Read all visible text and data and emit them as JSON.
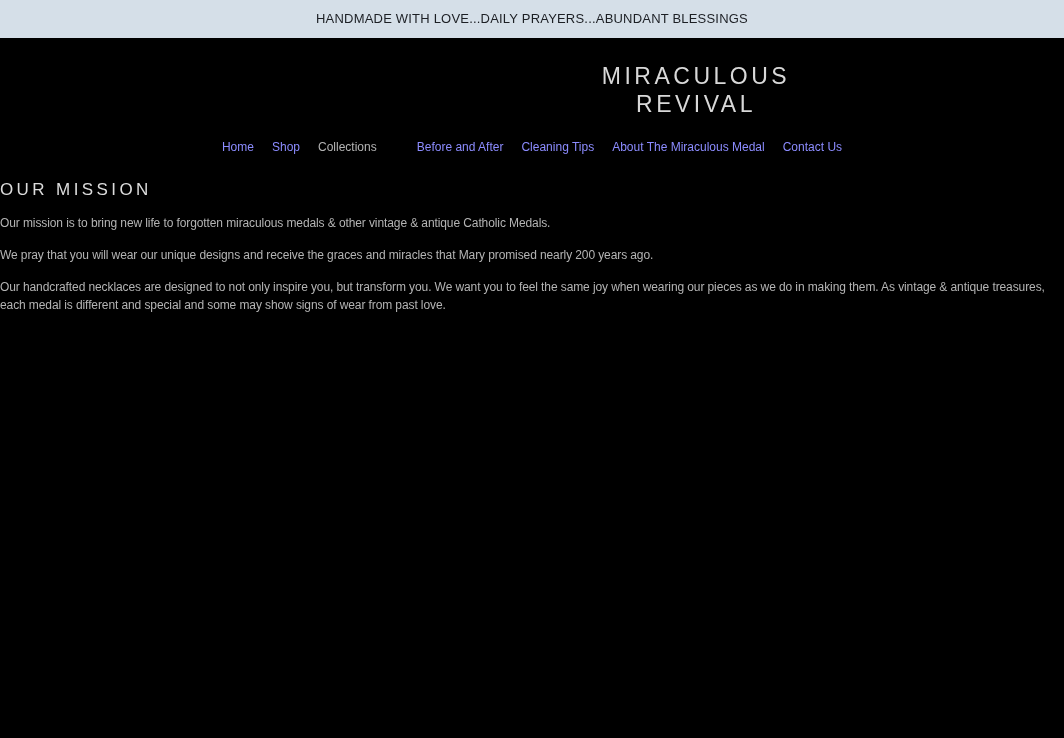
{
  "announcement_bar": {
    "text": "HANDMADE WITH LOVE...DAILY PRAYERS...ABUNDANT BLESSINGS"
  },
  "logo": {
    "lines": [
      "MIRACULOUS",
      "REVIVAL"
    ]
  },
  "nav": {
    "items": [
      {
        "label": "Home",
        "kind": "link"
      },
      {
        "label": "Shop",
        "kind": "link"
      },
      {
        "label": "Collections",
        "kind": "dropdown"
      },
      {
        "label": "Before and After",
        "kind": "link"
      },
      {
        "label": "Cleaning Tips",
        "kind": "link"
      },
      {
        "label": "About The Miraculous Medal",
        "kind": "link"
      },
      {
        "label": "Contact Us",
        "kind": "link"
      }
    ]
  },
  "mission": {
    "heading": "OUR MISSION",
    "paragraphs": [
      "Our mission is to bring new life to forgotten miraculous medals & other vintage & antique Catholic Medals.",
      "We pray that you will wear our unique designs and receive the graces and miracles that Mary promised nearly 200 years ago.",
      "Our handcrafted necklaces are designed to not only inspire you, but transform you. We want you to feel the same joy when wearing our pieces as we do in making them. As vintage & antique treasures, each medal is different and special and some may show signs of wear from past love."
    ]
  }
}
